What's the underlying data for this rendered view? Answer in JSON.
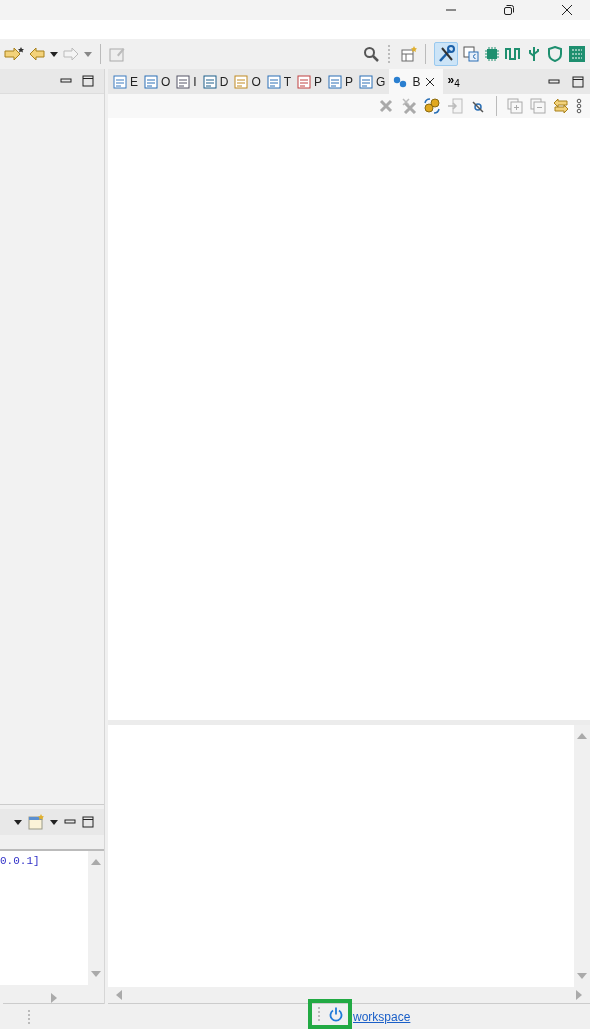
{
  "views": {
    "tabs": [
      {
        "label": "E",
        "selected": false
      },
      {
        "label": "O",
        "selected": false
      },
      {
        "label": "I",
        "selected": false
      },
      {
        "label": "D",
        "selected": false
      },
      {
        "label": "O",
        "selected": false
      },
      {
        "label": "T",
        "selected": false
      },
      {
        "label": "P",
        "selected": false
      },
      {
        "label": "P",
        "selected": false
      },
      {
        "label": "G",
        "selected": false
      },
      {
        "label": "B",
        "selected": true
      }
    ],
    "overflow": "»$_{4}$"
  },
  "console": {
    "lines": [
      "0.0.1]"
    ]
  },
  "status_bar": {
    "link": "workspace",
    "highlighted": true
  }
}
